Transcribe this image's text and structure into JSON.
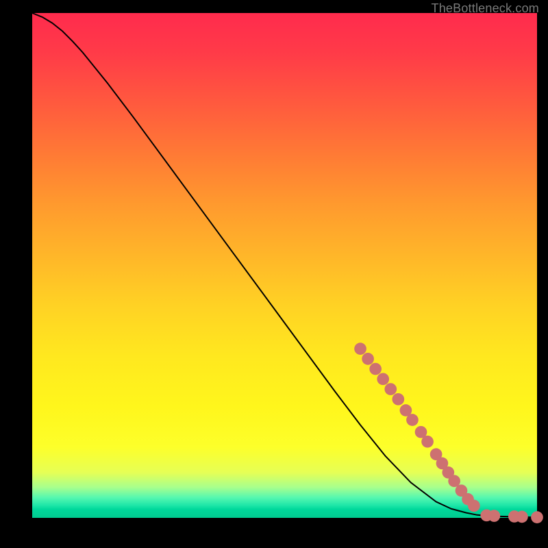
{
  "watermark": "TheBottleneck.com",
  "colors": {
    "curve": "#000000",
    "marker_fill": "#cd7171",
    "marker_stroke": "#cd7171"
  },
  "chart_data": {
    "type": "line",
    "title": "",
    "xlabel": "",
    "ylabel": "",
    "xlim": [
      0,
      100
    ],
    "ylim": [
      0,
      100
    ],
    "grid": false,
    "series": [
      {
        "name": "curve",
        "x": [
          0,
          2,
          4,
          6,
          8,
          10,
          15,
          20,
          30,
          40,
          50,
          60,
          65,
          70,
          75,
          80,
          83,
          86,
          88,
          90,
          92,
          94,
          96,
          98,
          100
        ],
        "y": [
          100,
          99.2,
          98.0,
          96.4,
          94.4,
          92.2,
          86.0,
          79.4,
          65.8,
          52.2,
          38.6,
          25.0,
          18.4,
          12.2,
          7.0,
          3.2,
          1.8,
          1.0,
          0.6,
          0.4,
          0.3,
          0.25,
          0.2,
          0.15,
          0.12
        ]
      }
    ],
    "markers": [
      {
        "x": 65.0,
        "y": 33.5
      },
      {
        "x": 66.5,
        "y": 31.5
      },
      {
        "x": 68.0,
        "y": 29.5
      },
      {
        "x": 69.5,
        "y": 27.5
      },
      {
        "x": 71.0,
        "y": 25.5
      },
      {
        "x": 72.5,
        "y": 23.5
      },
      {
        "x": 74.0,
        "y": 21.3
      },
      {
        "x": 75.3,
        "y": 19.4
      },
      {
        "x": 77.0,
        "y": 17.0
      },
      {
        "x": 78.3,
        "y": 15.1
      },
      {
        "x": 80.0,
        "y": 12.6
      },
      {
        "x": 81.2,
        "y": 10.8
      },
      {
        "x": 82.4,
        "y": 9.0
      },
      {
        "x": 83.6,
        "y": 7.3
      },
      {
        "x": 85.0,
        "y": 5.4
      },
      {
        "x": 86.3,
        "y": 3.7
      },
      {
        "x": 87.5,
        "y": 2.4
      },
      {
        "x": 90.0,
        "y": 0.5
      },
      {
        "x": 91.5,
        "y": 0.4
      },
      {
        "x": 95.5,
        "y": 0.28
      },
      {
        "x": 97.0,
        "y": 0.22
      },
      {
        "x": 100.0,
        "y": 0.12
      }
    ],
    "marker_radius_data_units": 1.2
  }
}
